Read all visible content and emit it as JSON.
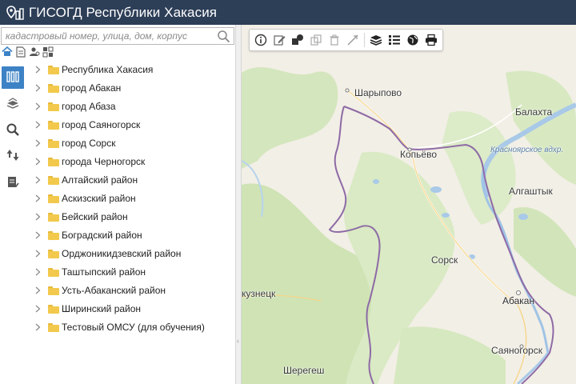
{
  "app": {
    "title": "ГИСОГД Республики Хакасия"
  },
  "search": {
    "placeholder": "кадастровый номер, улица, дом, корпус"
  },
  "sidebar_tools": [
    "home-icon",
    "document-icon",
    "user-search-icon",
    "grid-icon"
  ],
  "rail": [
    {
      "icon": "tree-icon",
      "active": true
    },
    {
      "icon": "layers-icon",
      "active": false
    },
    {
      "icon": "search-icon",
      "active": false
    },
    {
      "icon": "sort-icon",
      "active": false
    },
    {
      "icon": "report-icon",
      "active": false
    }
  ],
  "tree": {
    "items": [
      {
        "label": "Республика Хакасия"
      },
      {
        "label": "город Абакан"
      },
      {
        "label": "город Абаза"
      },
      {
        "label": "город Саяногорск"
      },
      {
        "label": "город Сорск"
      },
      {
        "label": "города Черногорск"
      },
      {
        "label": "Алтайский район"
      },
      {
        "label": "Аскизский район"
      },
      {
        "label": "Бейский район"
      },
      {
        "label": "Боградский район"
      },
      {
        "label": "Орджоникидзевский район"
      },
      {
        "label": "Таштыпский район"
      },
      {
        "label": "Усть-Абаканский район"
      },
      {
        "label": "Ширинский район"
      },
      {
        "label": "Тестовый ОМСУ (для обучения)"
      }
    ]
  },
  "map_toolbar": [
    "info-icon",
    "edit-icon",
    "shapes-icon",
    "copy-icon",
    "delete-icon",
    "measure-icon",
    "layers-icon",
    "list-icon",
    "globe-icon",
    "print-icon"
  ],
  "map": {
    "places": {
      "sharypovo": "Шарыпово",
      "balakhta": "Балахта",
      "kopyevo": "Копьёво",
      "reservoir": "Красноярское вдхр.",
      "algashtyk": "Алгаштык",
      "sorsk": "Сорск",
      "abakan": "Абакан",
      "kuznetsk": "кузнецк",
      "sayanogorsk": "Саяногорск",
      "sheregesh": "Шерегеш"
    }
  },
  "colors": {
    "header": "#2d3e57",
    "accent": "#3d82c5",
    "folder": "#f2c94c",
    "border_line": "#8e6aa6",
    "water": "#a9c9e8",
    "green": "#cfe3b5"
  }
}
